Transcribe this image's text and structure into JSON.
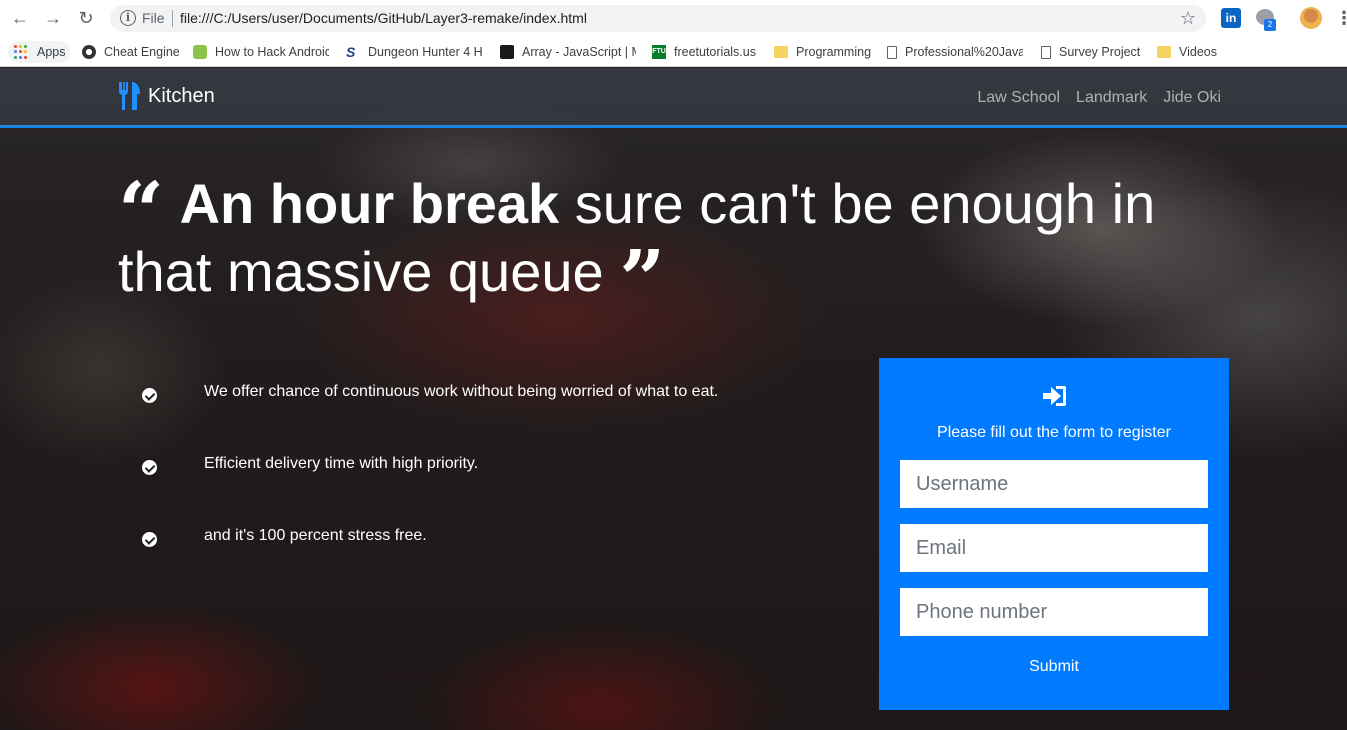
{
  "browser": {
    "scheme_label": "File",
    "url": "file:///C:/Users/user/Documents/GitHub/Layer3-remake/index.html",
    "extension_badge": "2",
    "extension_linkedin_label": "in"
  },
  "bookmarks": [
    {
      "label": "Apps",
      "icon": "apps-grid-icon"
    },
    {
      "label": "Cheat Engine",
      "icon": "cheat-engine-icon"
    },
    {
      "label": "How to Hack Androic",
      "icon": "android-icon"
    },
    {
      "label": "Dungeon Hunter 4 H",
      "icon": "s-logo-icon"
    },
    {
      "label": "Array - JavaScript | M",
      "icon": "mdn-icon"
    },
    {
      "label": "freetutorials.us",
      "icon": "ftu-icon"
    },
    {
      "label": "Programming",
      "icon": "folder-icon"
    },
    {
      "label": "Professional%20Java",
      "icon": "page-icon"
    },
    {
      "label": "Survey Project",
      "icon": "page-icon"
    },
    {
      "label": "Videos",
      "icon": "folder-icon"
    }
  ],
  "site": {
    "brand": "Kitchen",
    "nav_links": [
      "Law School",
      "Landmark",
      "Jide Oki"
    ],
    "hero": {
      "open_quote": "“",
      "bold_text": "An hour break",
      "rest_text": " sure can't be enough in that massive queue ",
      "close_quote": "”"
    },
    "features": [
      "We offer chance of continuous work without being worried of what to eat.",
      "Efficient delivery time with high priority.",
      "and it's 100 percent stress free."
    ],
    "form": {
      "title": "Please fill out the form to register",
      "username_placeholder": "Username",
      "email_placeholder": "Email",
      "phone_placeholder": "Phone number",
      "submit_label": "Submit"
    }
  },
  "colors": {
    "nav_bar": "#343a40",
    "nav_accent_line": "#1a86e0",
    "form_card": "#007bff",
    "brand_icon": "#1e90ff"
  }
}
